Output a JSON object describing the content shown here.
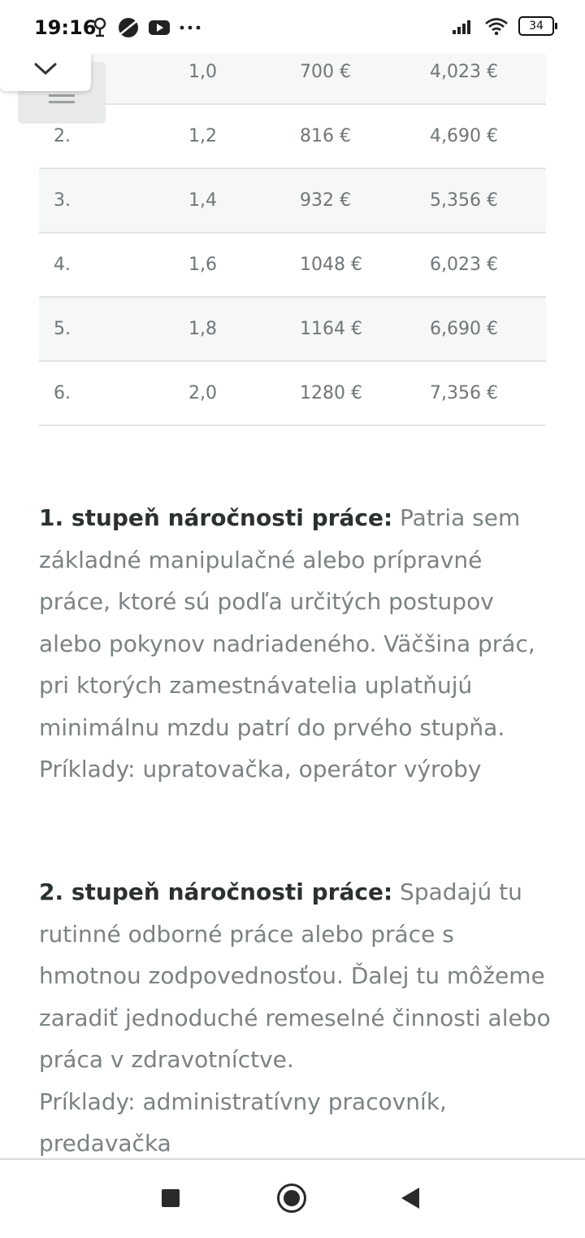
{
  "status_bar": {
    "time": "19:16",
    "icons_left": [
      "location-icon",
      "browser-icon",
      "youtube-icon",
      "more-dots-icon"
    ],
    "battery": "34"
  },
  "table": {
    "rows": [
      [
        "",
        "1,0",
        "700 €",
        "4,023 €"
      ],
      [
        "2.",
        "1,2",
        "816 €",
        "4,690 €"
      ],
      [
        "3.",
        "1,4",
        "932 €",
        "5,356 €"
      ],
      [
        "4.",
        "1,6",
        "1048 €",
        "6,023 €"
      ],
      [
        "5.",
        "1,8",
        "1164 €",
        "6,690 €"
      ],
      [
        "6.",
        "2,0",
        "1280 €",
        "7,356 €"
      ]
    ]
  },
  "sections": [
    {
      "lead": "1. stupeň náročnosti práce:",
      "text": " Patria sem základné manipulačné alebo prípravné práce, ktoré sú podľa určitých postupov alebo pokynov nadriadeného. Väčšina prác, pri ktorých zamestnávatelia uplatňujú minimálnu mzdu patrí do prvého stupňa.",
      "examples": "Príklady: upratovačka, operátor výroby"
    },
    {
      "lead": "2. stupeň náročnosti práce:",
      "text": " Spadajú tu rutinné odborné práce alebo práce s hmotnou zodpovednosťou. Ďalej tu môžeme zaradiť jednoduché remeselné činnosti alebo práca v zdravotníctve.",
      "examples": "Príklady: administratívny pracovník, predavačka"
    }
  ]
}
